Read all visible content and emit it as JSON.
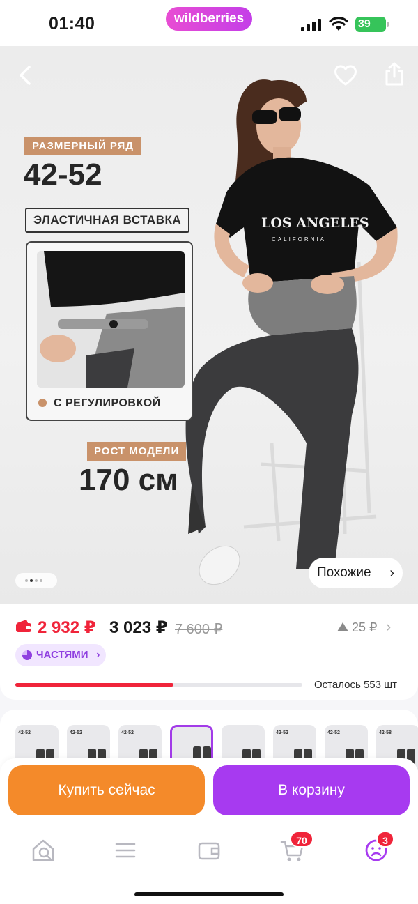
{
  "status_bar": {
    "time": "01:40",
    "brand": "wildberries",
    "battery": "39"
  },
  "product_image": {
    "size_label": "РАЗМЕРНЫЙ РЯД",
    "size_range": "42-52",
    "elastic_label": "ЭЛАСТИЧНАЯ ВСТАВКА",
    "adjust_label": "С РЕГУЛИРОВКОЙ",
    "height_label": "РОСТ МОДЕЛИ",
    "height_value": "170 см",
    "shirt_print": "LOS ANGELES",
    "shirt_sub": "CALIFORNIA",
    "similar_label": "Похожие",
    "carousel_dots": 4,
    "carousel_active": 1
  },
  "price": {
    "wallet_price": "2 932 ₽",
    "price": "3 023 ₽",
    "old_price": "7 600 ₽",
    "price_change": "25 ₽",
    "installment_label": "ЧАСТЯМИ",
    "stock_text": "Осталось 553 шт",
    "stock_fraction": 0.55
  },
  "thumbnails": [
    {
      "tag": "42-52",
      "active": false
    },
    {
      "tag": "42-52",
      "active": false
    },
    {
      "tag": "42-52",
      "active": false
    },
    {
      "tag": "",
      "active": true
    },
    {
      "tag": "",
      "active": false
    },
    {
      "tag": "42-52",
      "active": false
    },
    {
      "tag": "42-52",
      "active": false
    },
    {
      "tag": "42-58",
      "active": false
    }
  ],
  "actions": {
    "buy_now": "Купить сейчас",
    "add_to_cart": "В корзину"
  },
  "bottom_nav": {
    "items": [
      {
        "icon": "home-search-icon"
      },
      {
        "icon": "catalog-icon"
      },
      {
        "icon": "wallet-icon"
      },
      {
        "icon": "cart-icon",
        "badge": "70"
      },
      {
        "icon": "profile-icon",
        "badge": "3"
      }
    ]
  },
  "colors": {
    "accent": "#a73af0",
    "sale": "#f0243a",
    "buy_now": "#f48a2a",
    "badge_bg": "#c9926a"
  }
}
